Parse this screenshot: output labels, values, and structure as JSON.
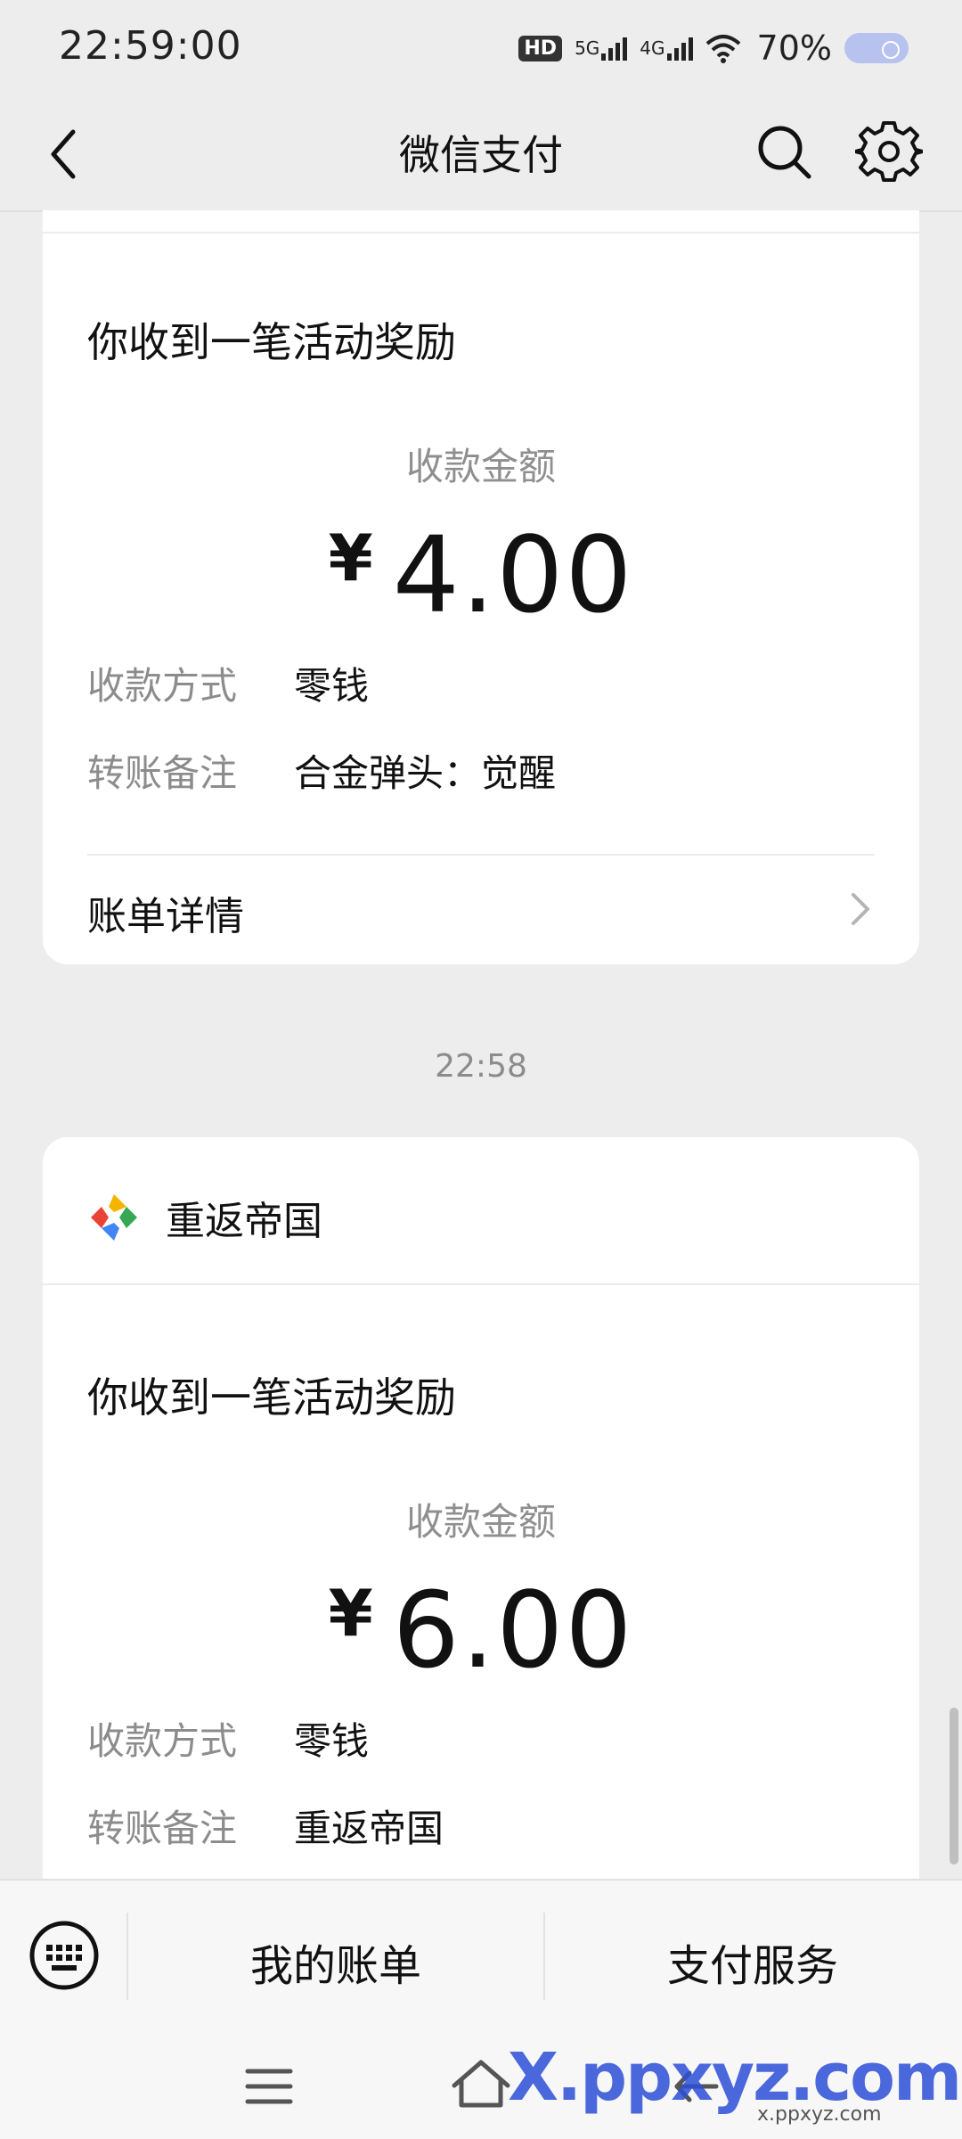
{
  "status_bar": {
    "time": "22:59:00",
    "hd": "HD",
    "net1": "5G",
    "net2": "4G",
    "battery": "70%"
  },
  "header": {
    "title": "微信支付"
  },
  "card1": {
    "heading": "你收到一笔活动奖励",
    "amount_label": "收款金额",
    "currency": "¥",
    "amount": "4.00",
    "method_key": "收款方式",
    "method_value": "零钱",
    "note_key": "转账备注",
    "note_value": "合金弹头：觉醒",
    "detail_label": "账单详情"
  },
  "time_separator": "22:58",
  "card2": {
    "merchant": "重返帝国",
    "heading": "你收到一笔活动奖励",
    "amount_label": "收款金额",
    "currency": "¥",
    "amount": "6.00",
    "method_key": "收款方式",
    "method_value": "零钱",
    "note_key": "转账备注",
    "note_value": "重返帝国"
  },
  "bottom_tabs": {
    "bills": "我的账单",
    "services": "支付服务"
  },
  "watermark": {
    "main": "X.ppxyz.com",
    "sub": "x.ppxyz.com"
  },
  "icons": {
    "back": "back-arrow-icon",
    "search": "search-icon",
    "settings": "gear-icon",
    "keyboard": "keyboard-icon",
    "chevron": "chevron-right-icon"
  }
}
